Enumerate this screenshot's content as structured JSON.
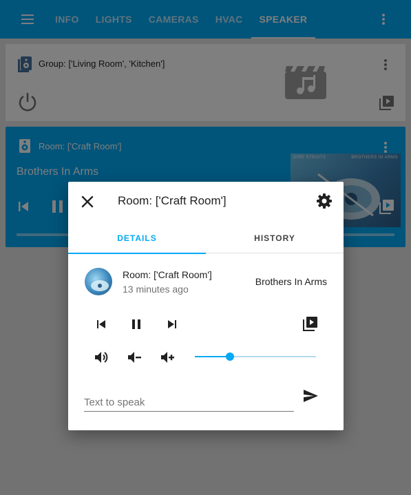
{
  "header": {
    "tabs": [
      {
        "label": "INFO",
        "active": false
      },
      {
        "label": "LIGHTS",
        "active": false
      },
      {
        "label": "CAMERAS",
        "active": false
      },
      {
        "label": "HVAC",
        "active": false
      },
      {
        "label": "SPEAKER",
        "active": true
      }
    ],
    "menu_icon": "hamburger-icon",
    "more_icon": "more-vert-icon"
  },
  "cards": {
    "group": {
      "title": "Group: ['Living Room', 'Kitchen']",
      "icon": "speaker-multiple-icon"
    },
    "room": {
      "title": "Room: ['Craft Room']",
      "track": "Brothers In Arms",
      "icon": "speaker-icon",
      "art_text_left": "DIRE STRAITS",
      "art_text_right": "BROTHERS IN ARMS"
    }
  },
  "dialog": {
    "title": "Room: ['Craft Room']",
    "tabs": [
      {
        "label": "DETAILS",
        "active": true
      },
      {
        "label": "HISTORY",
        "active": false
      }
    ],
    "entity": {
      "name": "Room: ['Craft Room']",
      "time": "13 minutes ago",
      "state": "Brothers In Arms"
    },
    "volume_level": 0.29,
    "tts": {
      "placeholder": "Text to speak",
      "value": ""
    }
  },
  "colors": {
    "primary": "#03a9f4",
    "header": "#03a9f4",
    "overlay": "rgba(0,0,0,0.5)"
  }
}
